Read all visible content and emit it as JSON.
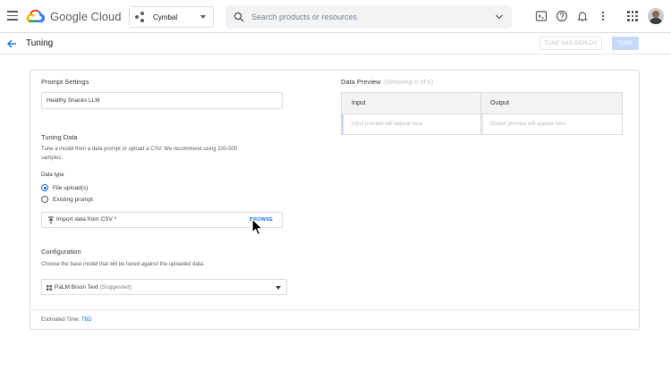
{
  "topbar": {
    "product_name": "Google Cloud",
    "project_name": "Cymbal",
    "search_placeholder": "Search products or resources",
    "icons": [
      "menu-icon",
      "google-cloud-logo",
      "project-icon",
      "search-icon",
      "chevron-down-icon",
      "cloud-shell-icon",
      "help-icon",
      "notifications-icon",
      "more-vert-icon",
      "apps-icon",
      "avatar"
    ]
  },
  "subheader": {
    "title": "Tuning",
    "tune_and_deploy_label": "TUNE AND DEPLOY",
    "tune_label": "TUNE"
  },
  "prompt_settings": {
    "title": "Prompt Settings",
    "name_value": "Healthy Snacks LLM"
  },
  "tuning_data": {
    "title": "Tuning Data",
    "description_line1": "Tune a model from a data prompt or upload a CSV. We recommend using 100-500",
    "description_line2": "samples.",
    "data_type_label": "Data type",
    "options": [
      {
        "label": "File upload(s)",
        "selected": true
      },
      {
        "label": "Existing prompt",
        "selected": false
      }
    ],
    "import_label": "Import data from CSV *",
    "browse_label": "BROWSE"
  },
  "configuration": {
    "title": "Configuration",
    "description": "Choose the base model that will be tuned against the uploaded data.",
    "model_value": "PaLM Bison Text",
    "model_suffix": "(Suggested)"
  },
  "footer": {
    "estimated_label": "Estimated Time:",
    "estimated_value": "TBD"
  },
  "data_preview": {
    "title": "Data Preview",
    "count": "(Showing 0 of 0)",
    "columns": [
      "Input",
      "Output"
    ],
    "placeholders": [
      "Input preview will appear here",
      "Output preview will appear here"
    ]
  },
  "colors": {
    "accent": "#1a73e8",
    "tune_button_disabled": "#c6dafc",
    "border": "#dadce0"
  }
}
